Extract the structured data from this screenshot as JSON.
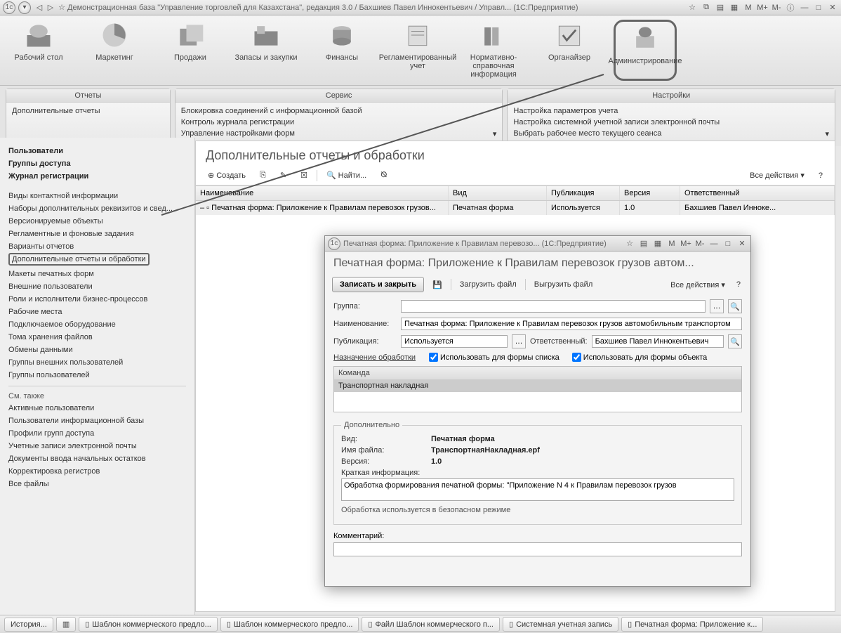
{
  "title": "Демонстрационная база \"Управление торговлей для Казахстана\", редакция 3.0 / Бахшиев Павел Иннокентьевич / Управл...  (1С:Предприятие)",
  "titlebar_right": {
    "m": "M",
    "mp": "M+",
    "mm": "M-"
  },
  "sections": [
    {
      "label": "Рабочий стол"
    },
    {
      "label": "Маркетинг"
    },
    {
      "label": "Продажи"
    },
    {
      "label": "Запасы и закупки"
    },
    {
      "label": "Финансы"
    },
    {
      "label": "Регламентированный учет"
    },
    {
      "label": "Нормативно-справочная информация"
    },
    {
      "label": "Органайзер"
    },
    {
      "label": "Администрирование"
    }
  ],
  "panels": {
    "reports": {
      "title": "Отчеты",
      "items": [
        "Дополнительные отчеты"
      ]
    },
    "service": {
      "title": "Сервис",
      "items": [
        "Блокировка соединений с информационной базой",
        "Контроль журнала регистрации",
        "Управление настройками форм"
      ]
    },
    "settings": {
      "title": "Настройки",
      "items": [
        "Настройка параметров учета",
        "Настройка системной учетной записи электронной почты",
        "Выбрать рабочее место текущего сеанса"
      ]
    }
  },
  "sidebar": {
    "bold": [
      "Пользователи",
      "Группы доступа",
      "Журнал регистрации"
    ],
    "links1": [
      "Виды контактной информации",
      "Наборы дополнительных реквизитов и свед...",
      "Версионируемые объекты",
      "Регламентные и фоновые задания",
      "Варианты отчетов",
      "Дополнительные отчеты и обработки",
      "Макеты печатных форм",
      "Внешние пользователи",
      "Роли и исполнители бизнес-процессов",
      "Рабочие места",
      "Подключаемое оборудование",
      "Тома хранения файлов",
      "Обмены данными",
      "Группы внешних пользователей",
      "Группы пользователей"
    ],
    "see_also": "См. также",
    "links2": [
      "Активные пользователи",
      "Пользователи информационной базы",
      "Профили групп доступа",
      "Учетные записи электронной почты",
      "Документы ввода начальных остатков",
      "Корректировка регистров",
      "Все файлы"
    ]
  },
  "content": {
    "title": "Дополнительные отчеты и обработки",
    "toolbar": {
      "create": "Создать",
      "find": "Найти...",
      "all_actions": "Все действия"
    },
    "columns": [
      "Наименование",
      "Вид",
      "Публикация",
      "Версия",
      "Ответственный"
    ],
    "row": [
      "Печатная форма: Приложение к Правилам перевозок грузов...",
      "Печатная форма",
      "Используется",
      "1.0",
      "Бахшиев Павел Инноке..."
    ]
  },
  "dialog": {
    "window_title": "Печатная форма: Приложение к Правилам перевозо...  (1С:Предприятие)",
    "heading": "Печатная форма: Приложение к Правилам перевозок грузов автом...",
    "save_close": "Записать и закрыть",
    "load": "Загрузить файл",
    "unload": "Выгрузить файл",
    "all_actions": "Все действия",
    "labels": {
      "group": "Группа:",
      "name": "Наименование:",
      "pub": "Публикация:",
      "resp": "Ответственный:",
      "assign": "Назначение обработки",
      "use_list": "Использовать для формы списка",
      "use_obj": "Использовать для формы объекта",
      "cmd": "Команда",
      "extra": "Дополнительно",
      "kind": "Вид:",
      "file": "Имя файла:",
      "ver": "Версия:",
      "brief": "Краткая информация:",
      "comment": "Комментарий:"
    },
    "values": {
      "group": "",
      "name": "Печатная форма: Приложение к Правилам перевозок грузов автомобильным транспортом",
      "pub": "Используется",
      "resp": "Бахшиев Павел Иннокентьевич",
      "cmd_row": "Транспортная накладная",
      "kind": "Печатная форма",
      "file": "ТранспортнаяНакладная.epf",
      "ver": "1.0",
      "brief": "Обработка формирования печатной формы: \"Приложение N 4 к Правилам перевозок грузов",
      "note": "Обработка используется в безопасном режиме",
      "comment": ""
    }
  },
  "taskbar": {
    "history": "История...",
    "tabs": [
      "Шаблон коммерческого предло...",
      "Шаблон коммерческого предло...",
      "Файл Шаблон коммерческого п...",
      "Системная учетная запись",
      "Печатная форма: Приложение к..."
    ]
  }
}
